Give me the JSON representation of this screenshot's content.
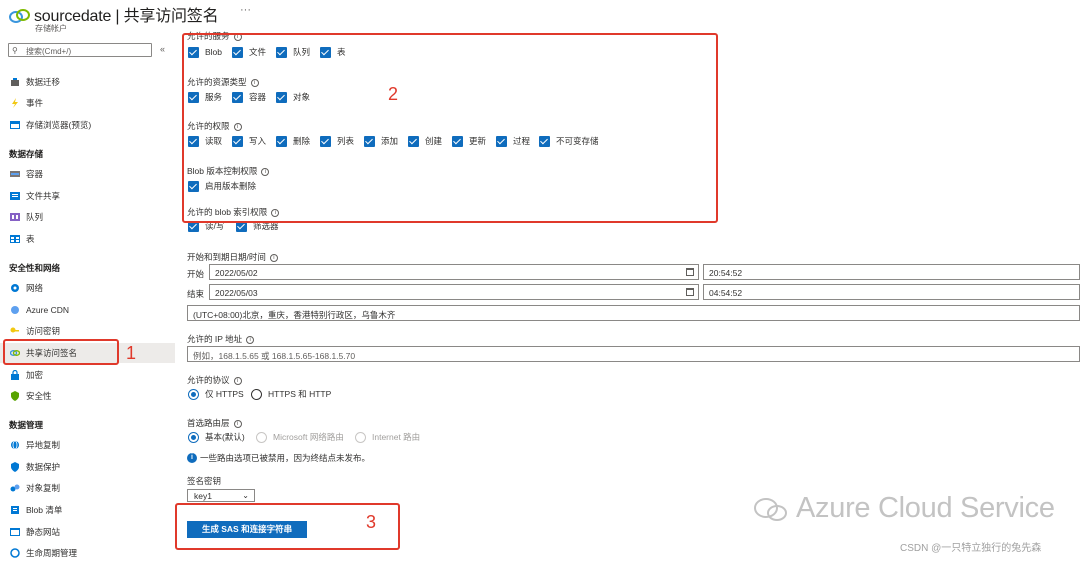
{
  "header": {
    "title": "sourcedate | 共享访问签名",
    "subtitle": "存储帐户",
    "more": "···"
  },
  "sidebar": {
    "search_placeholder": "搜索(Cmd+/)",
    "collapse": "«",
    "items_top": [
      {
        "label": "数据迁移",
        "icon": "data-migration-icon"
      },
      {
        "label": "事件",
        "icon": "lightning-icon"
      },
      {
        "label": "存储浏览器(预览)",
        "icon": "storage-browser-icon"
      }
    ],
    "sections": [
      {
        "title": "数据存储",
        "items": [
          {
            "label": "容器",
            "icon": "container-icon"
          },
          {
            "label": "文件共享",
            "icon": "file-share-icon"
          },
          {
            "label": "队列",
            "icon": "queue-icon"
          },
          {
            "label": "表",
            "icon": "table-icon"
          }
        ]
      },
      {
        "title": "安全性和网络",
        "items": [
          {
            "label": "网络",
            "icon": "network-icon"
          },
          {
            "label": "Azure CDN",
            "icon": "cdn-icon"
          },
          {
            "label": "访问密钥",
            "icon": "key-icon"
          },
          {
            "label": "共享访问签名",
            "icon": "link-icon"
          },
          {
            "label": "加密",
            "icon": "lock-icon"
          },
          {
            "label": "安全性",
            "icon": "shield-icon"
          }
        ]
      },
      {
        "title": "数据管理",
        "items": [
          {
            "label": "异地复制",
            "icon": "globe-icon"
          },
          {
            "label": "数据保护",
            "icon": "shield-icon"
          },
          {
            "label": "对象复制",
            "icon": "replicate-icon"
          },
          {
            "label": "Blob 清单",
            "icon": "inventory-icon"
          },
          {
            "label": "静态网站",
            "icon": "website-icon"
          },
          {
            "label": "生命周期管理",
            "icon": "lifecycle-icon"
          }
        ]
      }
    ]
  },
  "form": {
    "services_label": "允许的服务",
    "services": [
      "Blob",
      "文件",
      "队列",
      "表"
    ],
    "resource_types_label": "允许的资源类型",
    "resource_types": [
      "服务",
      "容器",
      "对象"
    ],
    "permissions_label": "允许的权限",
    "permissions": [
      "读取",
      "写入",
      "删除",
      "列表",
      "添加",
      "创建",
      "更新",
      "过程",
      "不可变存储"
    ],
    "blob_versioning_label": "Blob 版本控制权限",
    "blob_versioning": [
      "启用版本删除"
    ],
    "blob_index_label": "允许的 blob 索引权限",
    "blob_index": [
      "读/写",
      "筛选器"
    ],
    "datetime_label": "开始和到期日期/时间",
    "start_label": "开始",
    "start_date": "2022/05/02",
    "start_time": "20:54:52",
    "end_label": "结束",
    "end_date": "2022/05/03",
    "end_time": "04:54:52",
    "timezone": "(UTC+08:00)北京，重庆，香港特别行政区，乌鲁木齐",
    "ip_label": "允许的 IP 地址",
    "ip_placeholder": "例如，168.1.5.65 或 168.1.5.65-168.1.5.70",
    "protocol_label": "允许的协议",
    "protocols": [
      "仅 HTTPS",
      "HTTPS 和 HTTP"
    ],
    "routing_label": "首选路由层",
    "routing": [
      "基本(默认)",
      "Microsoft 网络路由",
      "Internet 路由"
    ],
    "routing_notice": "一些路由选项已被禁用，因为终结点未发布。",
    "signing_key_label": "签名密钥",
    "signing_key": "key1",
    "generate_button": "生成 SAS 和连接字符串"
  },
  "annotations": [
    "1",
    "2",
    "3"
  ],
  "watermark": {
    "text": "Azure Cloud Service",
    "csdn": "CSDN @一只特立独行的兔先森"
  },
  "colors": {
    "accent": "#0f6cbd",
    "annotation": "#e0392b"
  }
}
